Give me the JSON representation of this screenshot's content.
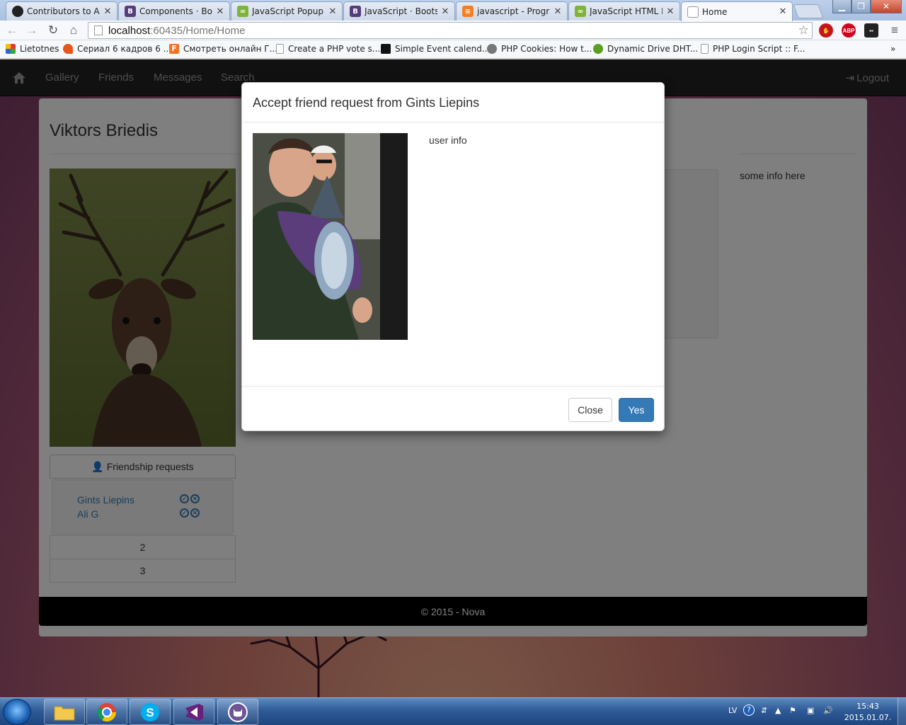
{
  "browser": {
    "tabs": [
      {
        "label": "Contributors to Artu",
        "icon": "github-icon"
      },
      {
        "label": "Components · Boots",
        "icon": "bootstrap-icon"
      },
      {
        "label": "JavaScript Popup Bo",
        "icon": "jsfiddle-icon"
      },
      {
        "label": "JavaScript · Bootstra",
        "icon": "bootstrap-icon"
      },
      {
        "label": "javascript - Program",
        "icon": "stackoverflow-icon"
      },
      {
        "label": "JavaScript HTML DO",
        "icon": "jsfiddle-icon"
      },
      {
        "label": "Home",
        "icon": "page-icon"
      }
    ],
    "url_host": "localhost",
    "url_path": ":60435/Home/Home",
    "bookmarks": [
      {
        "label": "Lietotnes",
        "icon": "apps-icon"
      },
      {
        "label": "Сериал 6 кадров 6 ...",
        "icon": "flame-icon"
      },
      {
        "label": "Смотреть онлайн Г...",
        "icon": "f-icon"
      },
      {
        "label": "Create a PHP vote s...",
        "icon": "page-icon"
      },
      {
        "label": "Simple Event calend...",
        "icon": "calendar-icon"
      },
      {
        "label": "PHP Cookies: How t...",
        "icon": "cookie-icon"
      },
      {
        "label": "Dynamic Drive DHT...",
        "icon": "dd-icon"
      },
      {
        "label": "PHP Login Script :: F...",
        "icon": "page-icon"
      }
    ],
    "bookmarks_overflow": "»"
  },
  "site": {
    "nav": [
      "Gallery",
      "Friends",
      "Messages",
      "Search"
    ],
    "logout": "Logout",
    "username": "Viktors Briedis",
    "friendship_requests_label": "Friendship requests",
    "requests": [
      {
        "name": "Gints Liepins"
      },
      {
        "name": "Ali G"
      }
    ],
    "pager": [
      "2",
      "3"
    ],
    "side_info": "some info here",
    "footer": "© 2015 - Nova"
  },
  "modal": {
    "title": "Accept friend request from Gints Liepins",
    "info": "user info",
    "close_label": "Close",
    "yes_label": "Yes"
  },
  "taskbar": {
    "language": "LV",
    "time": "15:43",
    "date": "2015.01.07."
  },
  "colors": {
    "primary": "#337ab7",
    "navbar": "#222222",
    "footer": "#000000"
  }
}
